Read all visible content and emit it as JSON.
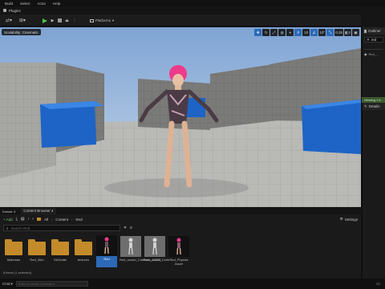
{
  "menu": [
    "Build",
    "Select",
    "Actor",
    "Help"
  ],
  "plugins_label": "Plugins",
  "toolbar": {
    "platforms_label": "Platforms"
  },
  "viewport": {
    "scalability_badge": "Scalability: Cinematic",
    "snap_angle": "10°",
    "snap_scale": "0.25",
    "camera_speed": "4"
  },
  "outliner": {
    "title": "Outliner",
    "search_value": "red",
    "items": [
      "Red_..."
    ]
  },
  "details": {
    "viewing_label": "Viewing 1 A",
    "title": "Details"
  },
  "content_browser": {
    "tabs": [
      "Drawer 3",
      "Content Browser 4"
    ],
    "add_label": "+ Add",
    "breadcrumb": [
      "All",
      "Content",
      "Red"
    ],
    "settings_label": "Settings",
    "search_placeholder": "Search Red",
    "items": [
      {
        "label": "Materials",
        "kind": "folder"
      },
      {
        "label": "Red_Skin",
        "kind": "folder"
      },
      {
        "label": "SKDrafts",
        "kind": "folder"
      },
      {
        "label": "textures",
        "kind": "folder"
      },
      {
        "label": "Red",
        "kind": "asset",
        "selected": true
      },
      {
        "label": "Red_model_Calibrate_LOD0",
        "kind": "asset"
      },
      {
        "label": "Red_model_Cloth",
        "kind": "asset"
      },
      {
        "label": "Red_Physics Asset",
        "kind": "asset"
      }
    ],
    "status": "8 items (1 selected)"
  },
  "bottom_bar": {
    "cmd_label": "Cmd",
    "console_placeholder": "Enter Console Command"
  },
  "colors": {
    "accent": "#2c6ab8",
    "folder": "#c48b2a",
    "cube": "#1d64c6",
    "hair": "#ee3a8a"
  }
}
